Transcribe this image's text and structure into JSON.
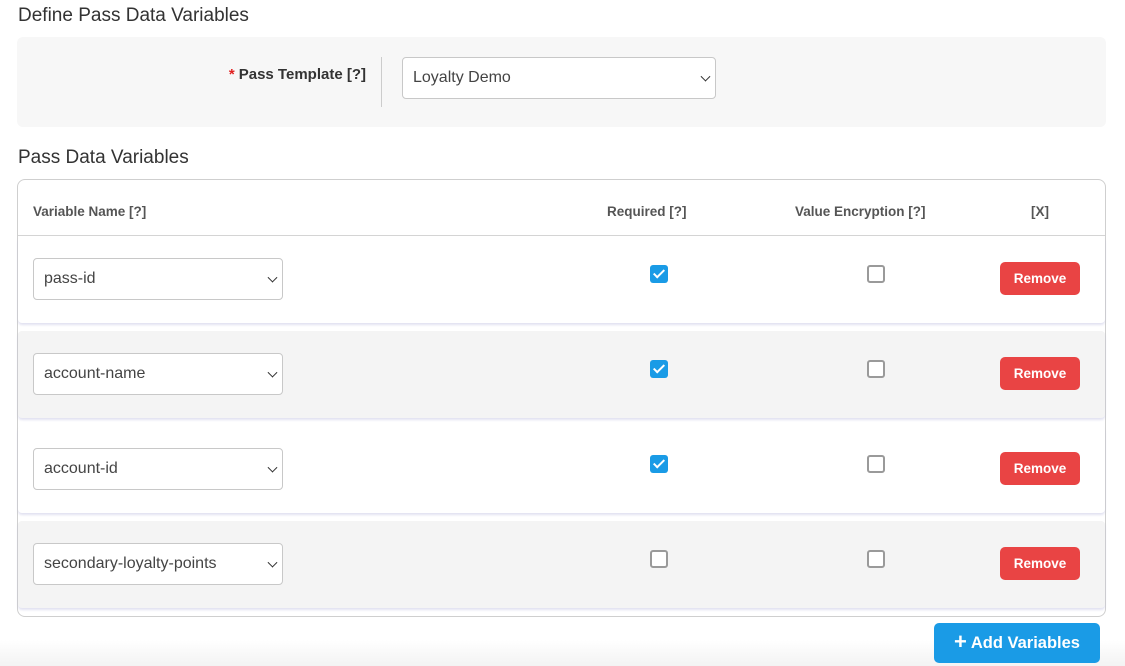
{
  "define_section": {
    "title": "Define Pass Data Variables",
    "template_field": {
      "required_marker": "*",
      "label": "Pass Template [?]",
      "selected_value": "Loyalty Demo"
    }
  },
  "variables_section": {
    "title": "Pass Data Variables",
    "columns": {
      "name": "Variable Name [?]",
      "required": "Required [?]",
      "encryption": "Value Encryption [?]",
      "remove": "[X]"
    },
    "rows": [
      {
        "variable": "pass-id",
        "required": true,
        "encryption": false,
        "remove_label": "Remove"
      },
      {
        "variable": "account-name",
        "required": true,
        "encryption": false,
        "remove_label": "Remove"
      },
      {
        "variable": "account-id",
        "required": true,
        "encryption": false,
        "remove_label": "Remove"
      },
      {
        "variable": "secondary-loyalty-points",
        "required": false,
        "encryption": false,
        "remove_label": "Remove"
      }
    ]
  },
  "actions": {
    "add_icon": "plus-icon",
    "add_label": "Add Variables"
  },
  "colors": {
    "primary": "#1a9be6",
    "danger": "#e94444",
    "required_star": "#e02020"
  }
}
